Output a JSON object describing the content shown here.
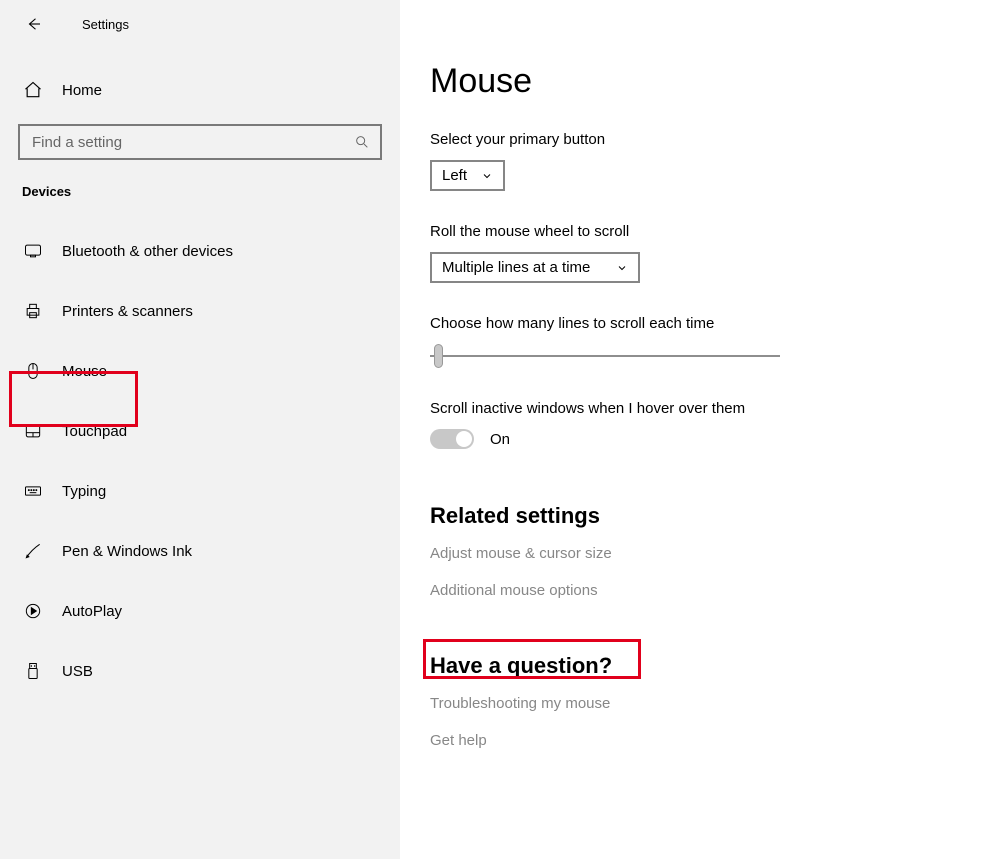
{
  "header": {
    "title": "Settings"
  },
  "sidebar": {
    "home_label": "Home",
    "search_placeholder": "Find a setting",
    "section_label": "Devices",
    "items": [
      {
        "label": "Bluetooth & other devices"
      },
      {
        "label": "Printers & scanners"
      },
      {
        "label": "Mouse"
      },
      {
        "label": "Touchpad"
      },
      {
        "label": "Typing"
      },
      {
        "label": "Pen & Windows Ink"
      },
      {
        "label": "AutoPlay"
      },
      {
        "label": "USB"
      }
    ]
  },
  "main": {
    "title": "Mouse",
    "primary_button_label": "Select your primary button",
    "primary_button_value": "Left",
    "wheel_scroll_label": "Roll the mouse wheel to scroll",
    "wheel_scroll_value": "Multiple lines at a time",
    "lines_label": "Choose how many lines to scroll each time",
    "scroll_inactive_label": "Scroll inactive windows when I hover over them",
    "scroll_inactive_value": "On",
    "related_heading": "Related settings",
    "related_links": [
      "Adjust mouse & cursor size",
      "Additional mouse options"
    ],
    "question_heading": "Have a question?",
    "question_links": [
      "Troubleshooting my mouse",
      "Get help"
    ]
  }
}
